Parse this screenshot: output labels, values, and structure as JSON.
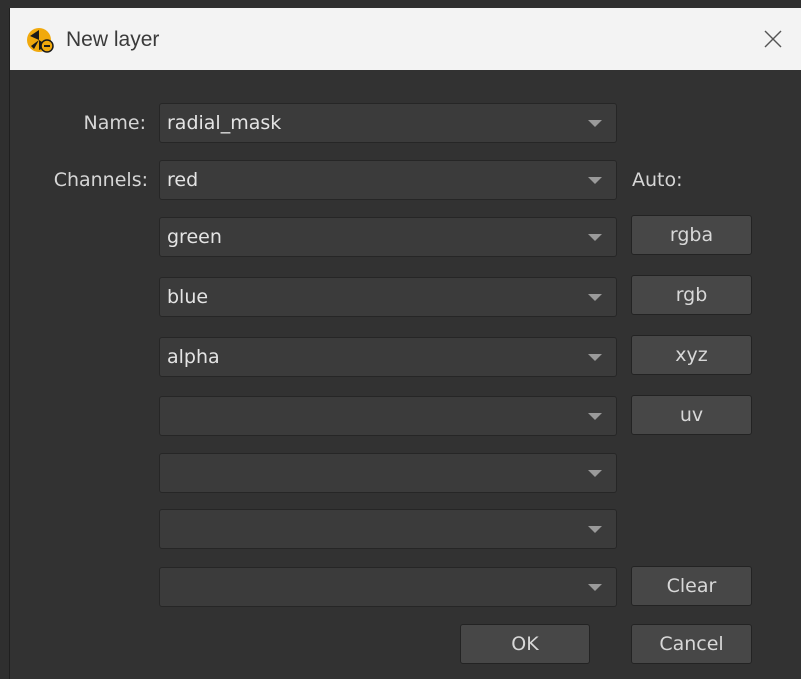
{
  "window": {
    "title": "New layer",
    "app_icon": "app-logo-icon",
    "close_icon": "close-icon"
  },
  "form": {
    "name_label": "Name:",
    "name_value": "radial_mask",
    "channels_label": "Channels:",
    "auto_label": "Auto:",
    "channels": [
      "red",
      "green",
      "blue",
      "alpha",
      "",
      "",
      "",
      ""
    ]
  },
  "auto_buttons": {
    "rgba": "rgba",
    "rgb": "rgb",
    "xyz": "xyz",
    "uv": "uv",
    "clear": "Clear"
  },
  "footer": {
    "ok": "OK",
    "cancel": "Cancel"
  }
}
